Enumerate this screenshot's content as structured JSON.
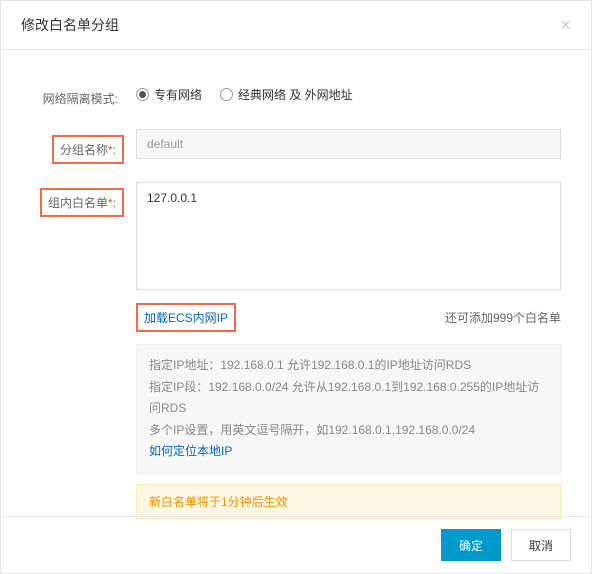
{
  "dialog": {
    "title": "修改白名单分组",
    "close": "×"
  },
  "form": {
    "network_mode": {
      "label": "网络隔离模式:",
      "options": [
        {
          "label": "专有网络",
          "checked": true
        },
        {
          "label": "经典网络 及 外网地址",
          "checked": false
        }
      ]
    },
    "group_name": {
      "label": "分组名称",
      "value": "default"
    },
    "whitelist": {
      "label": "组内白名单",
      "value": "127.0.0.1"
    },
    "load_ecs_link": "加载ECS内网IP",
    "quota_text": "还可添加999个白名单",
    "help": {
      "line1": "指定IP地址：192.168.0.1 允许192.168.0.1的IP地址访问RDS",
      "line2": "指定IP段：192.168.0.0/24 允许从192.168.0.1到192.168.0.255的IP地址访问RDS",
      "line3": "多个IP设置，用英文逗号隔开，如192.168.0.1,192.168.0.0/24",
      "locate_link": "如何定位本地IP"
    },
    "notice": "新白名单将于1分钟后生效"
  },
  "footer": {
    "ok": "确定",
    "cancel": "取消"
  }
}
